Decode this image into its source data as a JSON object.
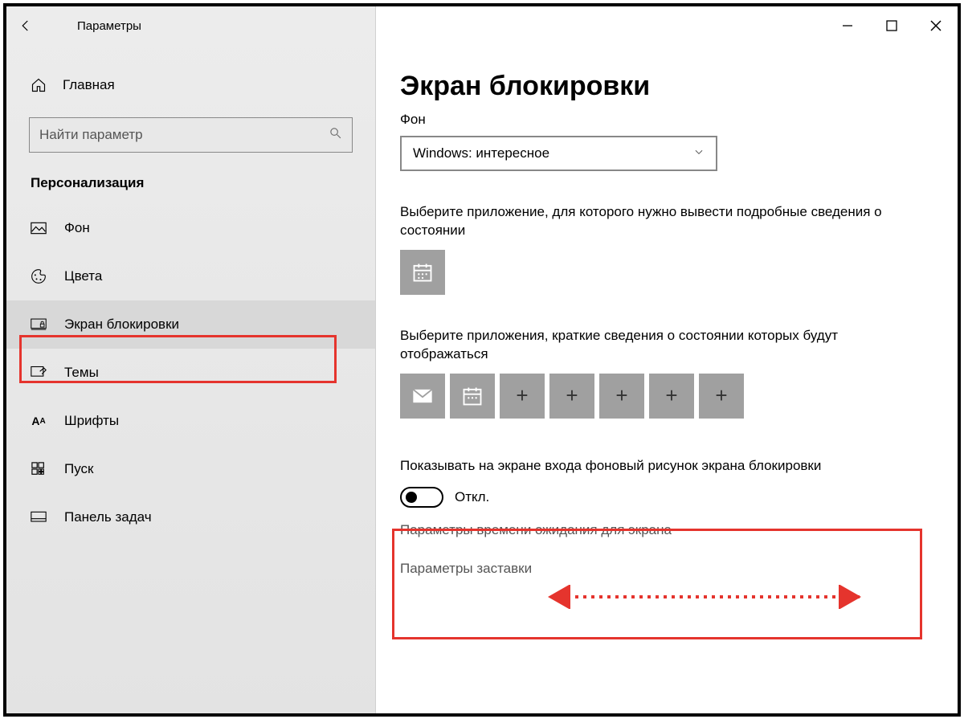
{
  "titlebar": {
    "title": "Параметры"
  },
  "sidebar": {
    "home": "Главная",
    "search_placeholder": "Найти параметр",
    "category": "Персонализация",
    "items": [
      {
        "label": "Фон"
      },
      {
        "label": "Цвета"
      },
      {
        "label": "Экран блокировки"
      },
      {
        "label": "Темы"
      },
      {
        "label": "Шрифты"
      },
      {
        "label": "Пуск"
      },
      {
        "label": "Панель задач"
      }
    ]
  },
  "main": {
    "heading": "Экран блокировки",
    "bg_label": "Фон",
    "bg_selected": "Windows: интересное",
    "detailed_label": "Выберите приложение, для которого нужно вывести подробные сведения о состоянии",
    "quick_label": "Выберите приложения, краткие сведения о состоянии которых будут отображаться",
    "toggle_label": "Показывать на экране входа фоновый рисунок экрана блокировки",
    "toggle_state": "Откл.",
    "link_timeout": "Параметры времени ожидания для экрана",
    "link_screensaver": "Параметры заставки"
  }
}
